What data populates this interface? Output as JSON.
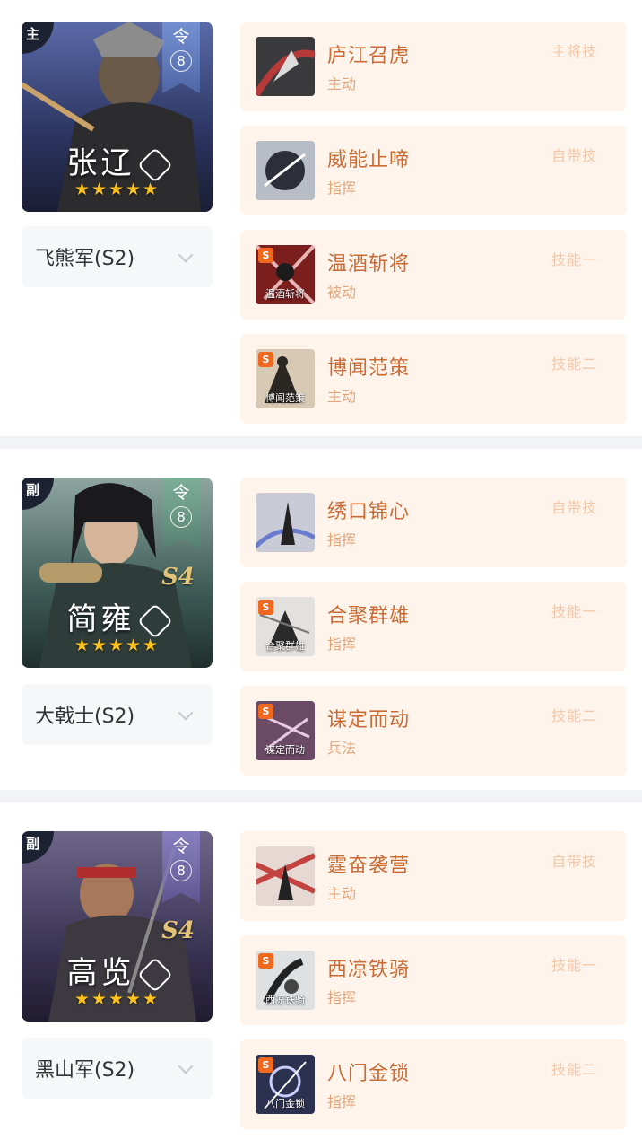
{
  "colors": {
    "skill_bg": "#fff4ec",
    "skill_name": "#c96b35",
    "skill_type": "#e0a57b",
    "skill_slot": "#f3c8a8",
    "star": "#ffc21a",
    "season_badge": "#f0691f"
  },
  "teams": [
    {
      "role": "主",
      "ling_label": "令",
      "ling_value": "8",
      "season_mark": "",
      "hero_name": "张辽",
      "type_icon": "cavalry-icon",
      "stars": "★★★★★",
      "troop": "飞熊军(S2)",
      "skills": [
        {
          "name": "庐江召虎",
          "type": "主动",
          "slot": "主将技",
          "season_badge": "",
          "caption": ""
        },
        {
          "name": "威能止啼",
          "type": "指挥",
          "slot": "自带技",
          "season_badge": "",
          "caption": ""
        },
        {
          "name": "温酒斩将",
          "type": "被动",
          "slot": "技能一",
          "season_badge": "S",
          "caption": "温酒斩将"
        },
        {
          "name": "博闻范策",
          "type": "主动",
          "slot": "技能二",
          "season_badge": "S",
          "caption": "博闻范策"
        }
      ]
    },
    {
      "role": "副",
      "ling_label": "令",
      "ling_value": "8",
      "season_mark": "S4",
      "hero_name": "简雍",
      "type_icon": "shield-icon",
      "stars": "★★★★★",
      "troop": "大戟士(S2)",
      "skills": [
        {
          "name": "绣口锦心",
          "type": "指挥",
          "slot": "自带技",
          "season_badge": "",
          "caption": ""
        },
        {
          "name": "合聚群雄",
          "type": "指挥",
          "slot": "技能一",
          "season_badge": "S",
          "caption": "合聚群雄"
        },
        {
          "name": "谋定而动",
          "type": "兵法",
          "slot": "技能二",
          "season_badge": "S",
          "caption": "谋定而动"
        }
      ]
    },
    {
      "role": "副",
      "ling_label": "令",
      "ling_value": "8",
      "season_mark": "S4",
      "hero_name": "高览",
      "type_icon": "shield-icon",
      "stars": "★★★★★",
      "troop": "黑山军(S2)",
      "skills": [
        {
          "name": "霆奋袭营",
          "type": "主动",
          "slot": "自带技",
          "season_badge": "",
          "caption": ""
        },
        {
          "name": "西凉铁骑",
          "type": "指挥",
          "slot": "技能一",
          "season_badge": "S",
          "caption": "西凉铁骑"
        },
        {
          "name": "八门金锁",
          "type": "指挥",
          "slot": "技能二",
          "season_badge": "S",
          "caption": "八门金锁"
        }
      ]
    }
  ]
}
